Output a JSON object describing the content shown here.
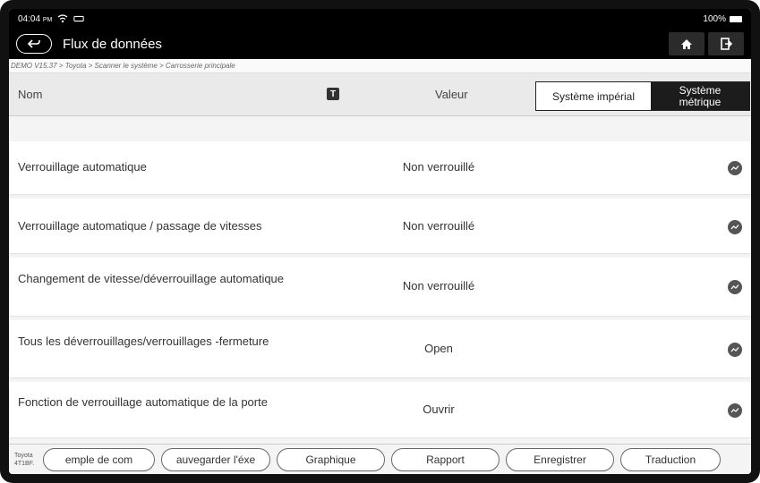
{
  "status_bar": {
    "time": "04:04",
    "ampm": "PM",
    "battery": "100%"
  },
  "title_bar": {
    "title": "Flux de données"
  },
  "breadcrumb": "DEMO V15.37 > Toyota > Scanner le système > Carrosserie principale",
  "header": {
    "name_label": "Nom",
    "value_label": "Valeur",
    "units": {
      "imperial": "Système impérial",
      "metric_line1": "Système",
      "metric_line2": "métrique",
      "selected": "metric"
    }
  },
  "rows": [
    {
      "name": "Verrouillage automatique",
      "value": "Non verrouillé"
    },
    {
      "name": "Verrouillage automatique / passage de vitesses",
      "value": "Non verrouillé"
    },
    {
      "name": "Changement de vitesse/déverrouillage automatique",
      "value": "Non verrouillé"
    },
    {
      "name": "Tous les déverrouillages/verrouillages -fermeture",
      "value": "Open"
    },
    {
      "name": "Fonction de verrouillage automatique de la porte",
      "value": "Ouvrir"
    }
  ],
  "bottom_bar": {
    "vin_line1": "Toyota",
    "vin_line2": "4T1BF.",
    "buttons": [
      "emple de com",
      "auvegarder l'éxe",
      "Graphique",
      "Rapport",
      "Enregistrer",
      "Traduction"
    ]
  }
}
